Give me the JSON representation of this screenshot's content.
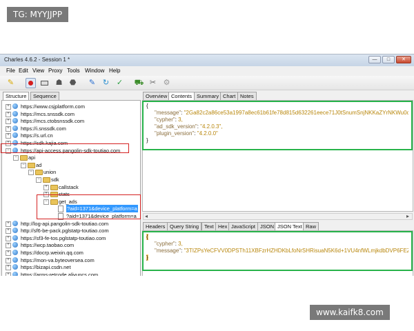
{
  "watermark_top": "TG: MYYJJPP",
  "watermark_bottom": "www.kaifk8.com",
  "window": {
    "title": "Charles 4.6.2 - Session 1 *",
    "min": "—",
    "max": "□",
    "close": "✕"
  },
  "menu": [
    "File",
    "Edit",
    "View",
    "Proxy",
    "Tools",
    "Window",
    "Help"
  ],
  "left_tabs": [
    "Structure",
    "Sequence"
  ],
  "tree": [
    {
      "label": "https://www.csjplatform.com",
      "depth": 0,
      "icon": "globe-icon",
      "exp": "+"
    },
    {
      "label": "https://mcs.snssdk.com",
      "depth": 0,
      "icon": "globe-icon",
      "exp": "+"
    },
    {
      "label": "https://mcs.ctobsnssdk.com",
      "depth": 0,
      "icon": "globe-icon",
      "exp": "+"
    },
    {
      "label": "https://i.snssdk.com",
      "depth": 0,
      "icon": "globe-icon",
      "exp": "+"
    },
    {
      "label": "https://s.url.cn",
      "depth": 0,
      "icon": "globe-icon",
      "exp": "+"
    },
    {
      "label": "https://sdk.kajia.com",
      "depth": 0,
      "icon": "globe-icon",
      "exp": "+"
    },
    {
      "label": "https://api-access.pangolin-sdk-toutiao.com",
      "depth": 0,
      "icon": "globe-icon",
      "exp": "−"
    },
    {
      "label": "api",
      "depth": 1,
      "icon": "folder-icon",
      "exp": "−"
    },
    {
      "label": "ad",
      "depth": 2,
      "icon": "folder-icon",
      "exp": "−"
    },
    {
      "label": "union",
      "depth": 3,
      "icon": "folder-icon",
      "exp": "−"
    },
    {
      "label": "sdk",
      "depth": 4,
      "icon": "folder-icon",
      "exp": "−"
    },
    {
      "label": "callstack",
      "depth": 5,
      "icon": "folder-icon",
      "exp": "+"
    },
    {
      "label": "stats",
      "depth": 5,
      "icon": "folder-icon",
      "exp": "+"
    },
    {
      "label": "get_ads",
      "depth": 5,
      "icon": "folder-icon",
      "exp": "−"
    },
    {
      "label": "?aid=1371&device_platform=a",
      "depth": 6,
      "icon": "document-icon",
      "exp": "",
      "selected": true
    },
    {
      "label": "?aid=1371&device_platform=a",
      "depth": 6,
      "icon": "document-icon",
      "exp": ""
    },
    {
      "label": "http://log-api.pangolin-sdk-toutiao.com",
      "depth": 0,
      "icon": "globe-icon",
      "exp": "+"
    },
    {
      "label": "http://sf6-be-pack.pglstatp-toutiao.com",
      "depth": 0,
      "icon": "globe-icon",
      "exp": "+"
    },
    {
      "label": "https://sf3-fe-tos.pglstatp-toutiao.com",
      "depth": 0,
      "icon": "globe-icon",
      "exp": "+"
    },
    {
      "label": "https://wcp.taobao.com",
      "depth": 0,
      "icon": "globe-icon",
      "exp": "+"
    },
    {
      "label": "https://docrp.weixin.qq.com",
      "depth": 0,
      "icon": "globe-icon",
      "exp": "+"
    },
    {
      "label": "https://mon-va.byteoversea.com",
      "depth": 0,
      "icon": "globe-icon",
      "exp": "+"
    },
    {
      "label": "https://bizapi.csdn.net",
      "depth": 0,
      "icon": "globe-icon",
      "exp": "+"
    },
    {
      "label": "https://arms-retcode.aliyuncs.com",
      "depth": 0,
      "icon": "globe-icon",
      "exp": "+"
    }
  ],
  "top_tabs": [
    "Overview",
    "Contents",
    "Summary",
    "Chart",
    "Notes"
  ],
  "request_body": {
    "open": "{",
    "lines": [
      {
        "key": "\"message\"",
        "value": "\"2Ga82c2a86ce53a1997a8ec61b61fe78d815d632261eece71J0tSnumSnjNKKaZYrNKWu0c8T2491aZd720qGtNlnuSx\","
      },
      {
        "key": "\"cypher\"",
        "value": "3,"
      },
      {
        "key": "\"ad_sdk_version\"",
        "value": "\"4.2.0.3\","
      },
      {
        "key": "\"plugin_version\"",
        "value": "\"4.2.0.0\""
      }
    ],
    "close": "}"
  },
  "bottom_tabs": [
    "Headers",
    "Query String",
    "Text",
    "Hex",
    "JavaScript",
    "JSON",
    "JSON Text",
    "Raw"
  ],
  "response_body": {
    "open": "{",
    "lines": [
      {
        "key": "\"cypher\"",
        "value": "3,"
      },
      {
        "key": "\"message\"",
        "value": "\"3TIZPsYeCFVV0DPSTh11XBFzrHZHDKbLfoNrSHRisuaN5K6d+1VU4nfWLmjkdbDVP6FEZs4m0nCe0VkN14+2ZPsEjUeAv\""
      }
    ],
    "close": "}"
  },
  "scroll_left": "◂",
  "scroll_right": "▸"
}
